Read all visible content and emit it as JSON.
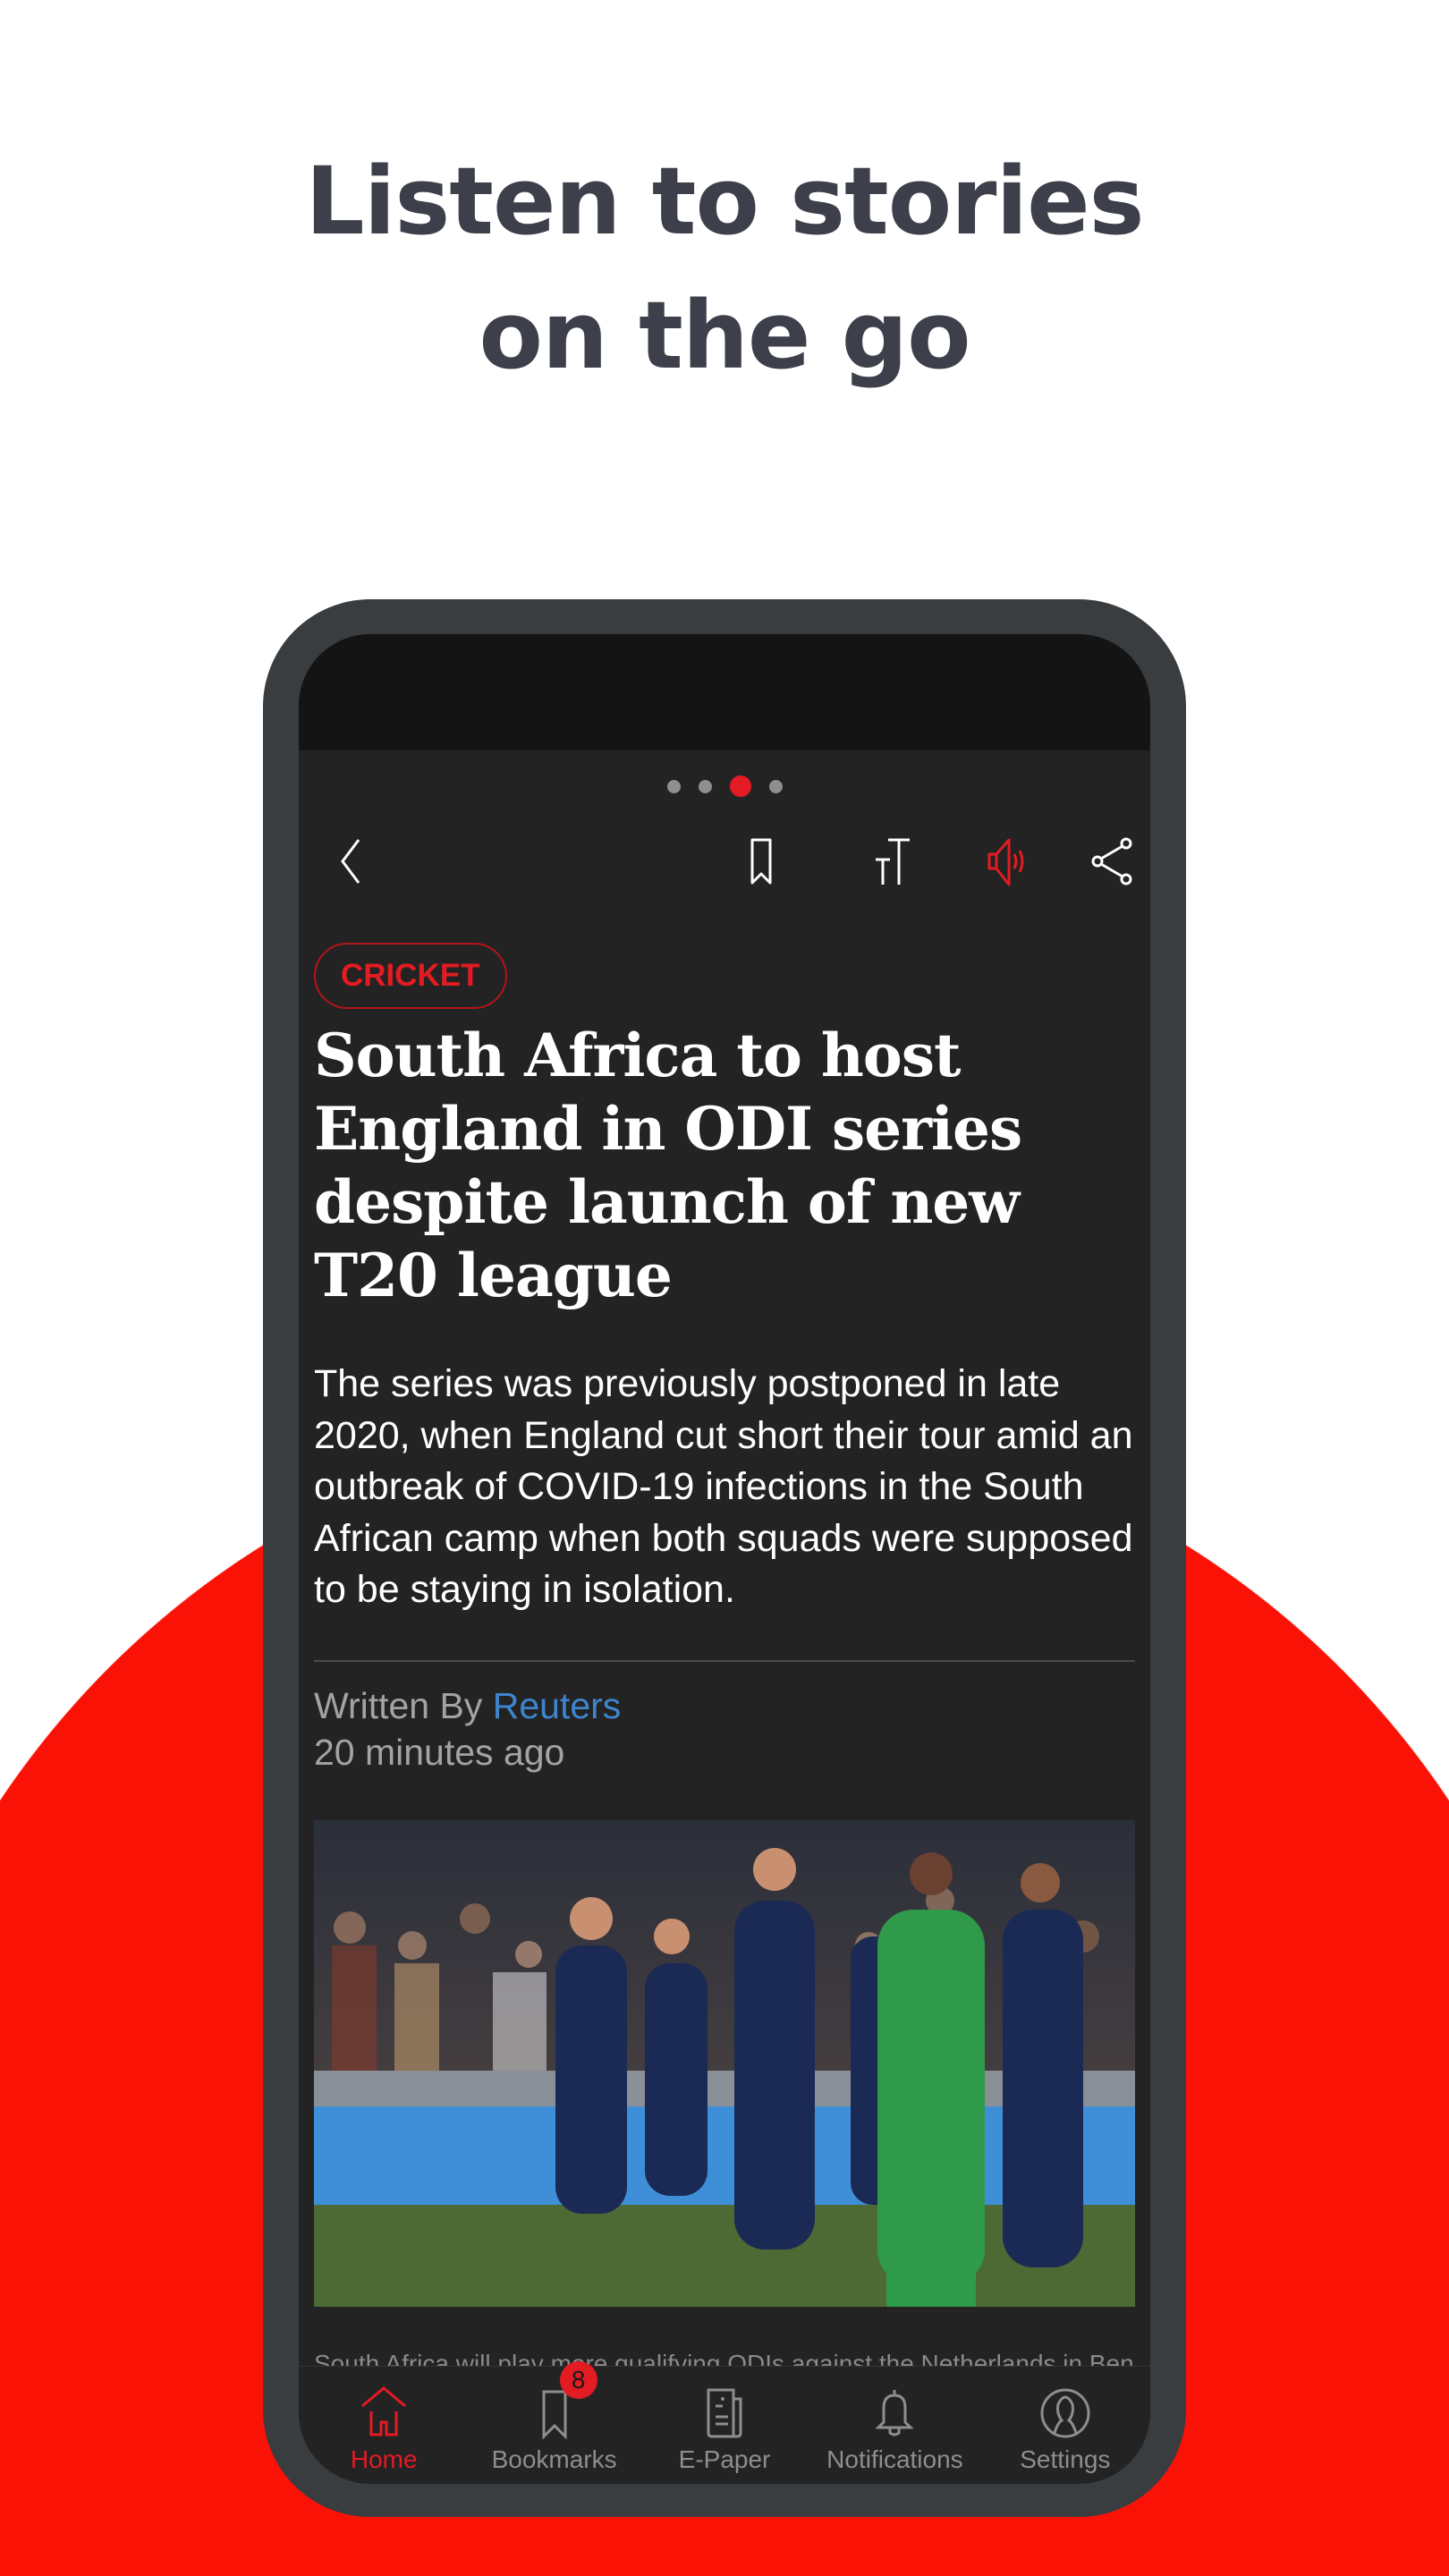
{
  "promo": {
    "headline_line1": "Listen to stories",
    "headline_line2": "on the go"
  },
  "colors": {
    "accent": "#e31b23",
    "promo_red": "#fb1207",
    "author_link": "#3d86cf"
  },
  "pager": {
    "count": 4,
    "active_index": 2
  },
  "toolbar": {
    "icons": [
      "back-icon",
      "bookmark-icon",
      "text-size-icon",
      "speaker-icon",
      "share-icon"
    ],
    "listen_active": true
  },
  "article": {
    "category": "CRICKET",
    "title": "South Africa to host England in ODI series despite launch of new T20 league",
    "summary": "The series was previously postponed in late 2020, when England cut short their tour amid an outbreak of COVID-19 infections in the South African camp when both squads were supposed to be staying in isolation.",
    "written_by_label": "Written By",
    "author": "Reuters",
    "time": "20 minutes ago",
    "caption": "South Africa will play more qualifying ODIs against the Netherlands in Benoni"
  },
  "nav": {
    "items": [
      {
        "label": "Home",
        "icon": "home-icon",
        "active": true
      },
      {
        "label": "Bookmarks",
        "icon": "bookmark-icon",
        "badge": "8"
      },
      {
        "label": "E-Paper",
        "icon": "newspaper-icon"
      },
      {
        "label": "Notifications",
        "icon": "bell-icon"
      },
      {
        "label": "Settings",
        "icon": "profile-icon"
      }
    ]
  }
}
